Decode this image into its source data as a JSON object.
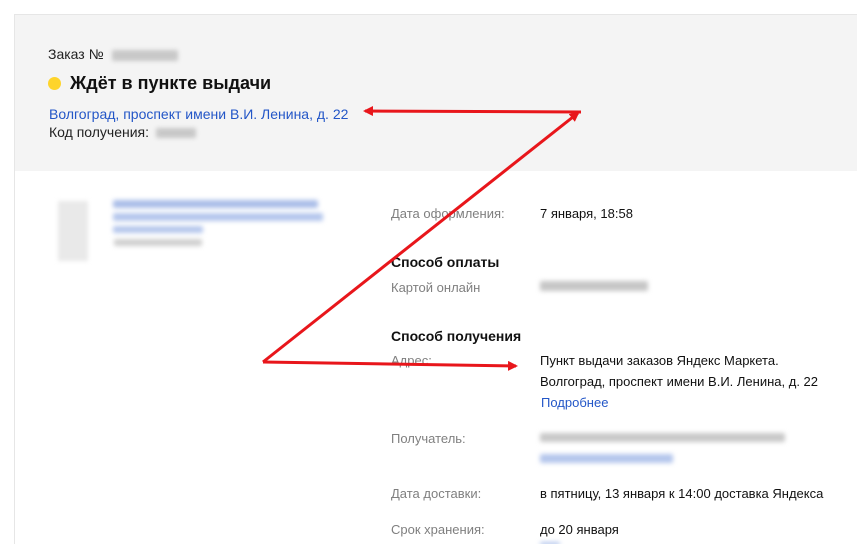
{
  "header": {
    "order_label": "Заказ №",
    "status": "Ждёт в пункте выдачи",
    "status_color": "#fed42b",
    "address_link": "Волгоград, проспект имени В.И. Ленина, д. 22",
    "pickup_code_label": "Код получения:"
  },
  "details": {
    "order_date_label": "Дата оформления:",
    "order_date_value": "7 января, 18:58",
    "payment_title": "Способ оплаты",
    "payment_method_label": "Картой онлайн",
    "delivery_title": "Способ получения",
    "address_label": "Адрес:",
    "address_line1": "Пункт выдачи заказов Яндекс Маркета.",
    "address_line2": "Волгоград, проспект имени В.И. Ленина, д. 22",
    "more_link": "Подробнее",
    "recipient_label": "Получатель:",
    "delivery_date_label": "Дата доставки:",
    "delivery_date_value": "в пятницу, 13 января к 14:00 доставка Яндекса",
    "storage_label": "Срок хранения:",
    "storage_value": "до 20 января"
  },
  "colors": {
    "link": "#2356c7",
    "arrow": "#e8161b",
    "header_bg": "#f4f4f4"
  }
}
